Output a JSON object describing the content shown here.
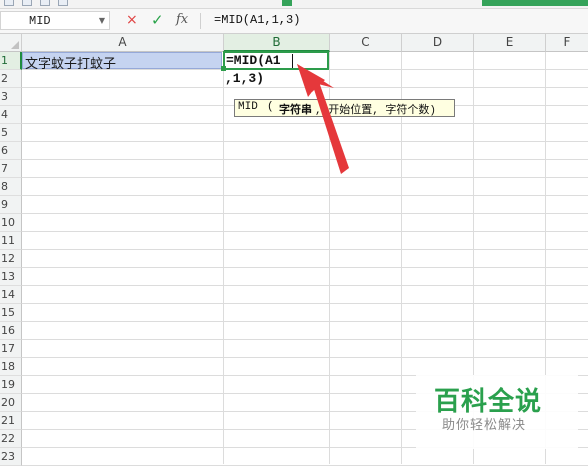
{
  "formula_bar": {
    "name_box": "MID",
    "cancel_icon": "×",
    "enter_icon": "✓",
    "fx_label": "fx",
    "formula": "=MID(A1,1,3)"
  },
  "columns": [
    "A",
    "B",
    "C",
    "D",
    "E",
    "F"
  ],
  "active_column": "B",
  "rows": [
    "1",
    "2",
    "3",
    "4",
    "5",
    "6",
    "7",
    "8",
    "9",
    "10",
    "11",
    "12",
    "13",
    "14",
    "15",
    "16",
    "17",
    "18",
    "19",
    "20",
    "21",
    "22",
    "23"
  ],
  "cells": {
    "A1": "文字蚊子打蚊子"
  },
  "editor": {
    "line1": "=MID(A1",
    "line2": ",1,3)"
  },
  "tooltip": {
    "fn": "MID",
    "paren_open": "(",
    "arg_current": "字符串",
    "rest": ", 开始位置, 字符个数)"
  },
  "watermark": {
    "brand": "百科全说",
    "slogan": "助你轻松解决"
  },
  "colors": {
    "accent_green": "#2d9c4b",
    "selection_fill": "#c5d3f0",
    "arrow_red": "#e5383b",
    "tooltip_bg": "#ffffe1"
  }
}
